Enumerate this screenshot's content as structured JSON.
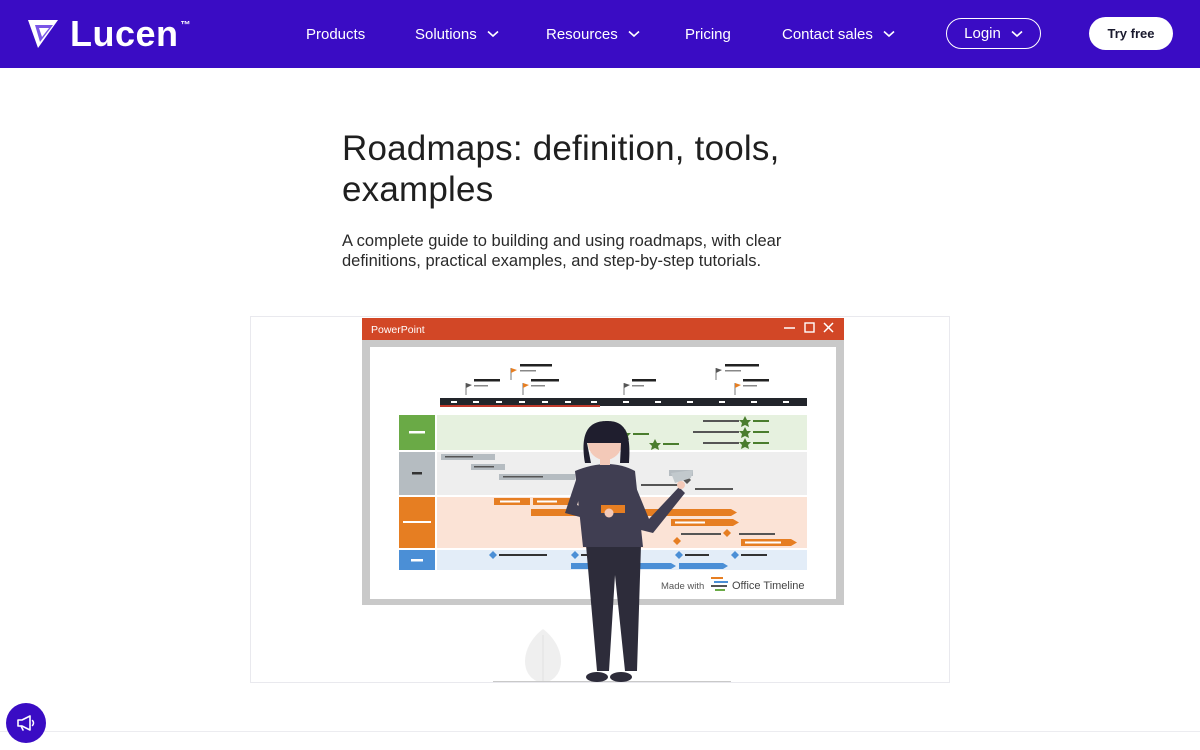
{
  "brand": {
    "name": "Lucen",
    "trademark": "™"
  },
  "nav": {
    "items": [
      {
        "label": "Products",
        "has_dropdown": false
      },
      {
        "label": "Solutions",
        "has_dropdown": true
      },
      {
        "label": "Resources",
        "has_dropdown": true
      },
      {
        "label": "Pricing",
        "has_dropdown": false
      },
      {
        "label": "Contact sales",
        "has_dropdown": true
      }
    ],
    "login_label": "Login",
    "try_label": "Try free"
  },
  "hero": {
    "title_line1": "Roadmaps: definition, tools,",
    "title_line2": "examples",
    "subtitle_line1": "A complete guide to building and using roadmaps, with clear",
    "subtitle_line2": "definitions, practical examples, and step-by-step tutorials."
  },
  "illustration": {
    "window_title": "PowerPoint",
    "made_with": "Made with",
    "made_with_brand": "Office Timeline"
  },
  "icons": {
    "logo": "triangle-play-logo-icon",
    "dropdown": "chevron-down-icon",
    "announce": "megaphone-icon",
    "window_controls": [
      "minimize-icon",
      "maximize-icon",
      "close-icon"
    ]
  },
  "colors": {
    "nav_bg": "#3a0cc4",
    "accent_orange": "#e67e22",
    "accent_green": "#6aaa46",
    "accent_blue": "#4b8fd6",
    "ppt_red": "#d24726"
  }
}
